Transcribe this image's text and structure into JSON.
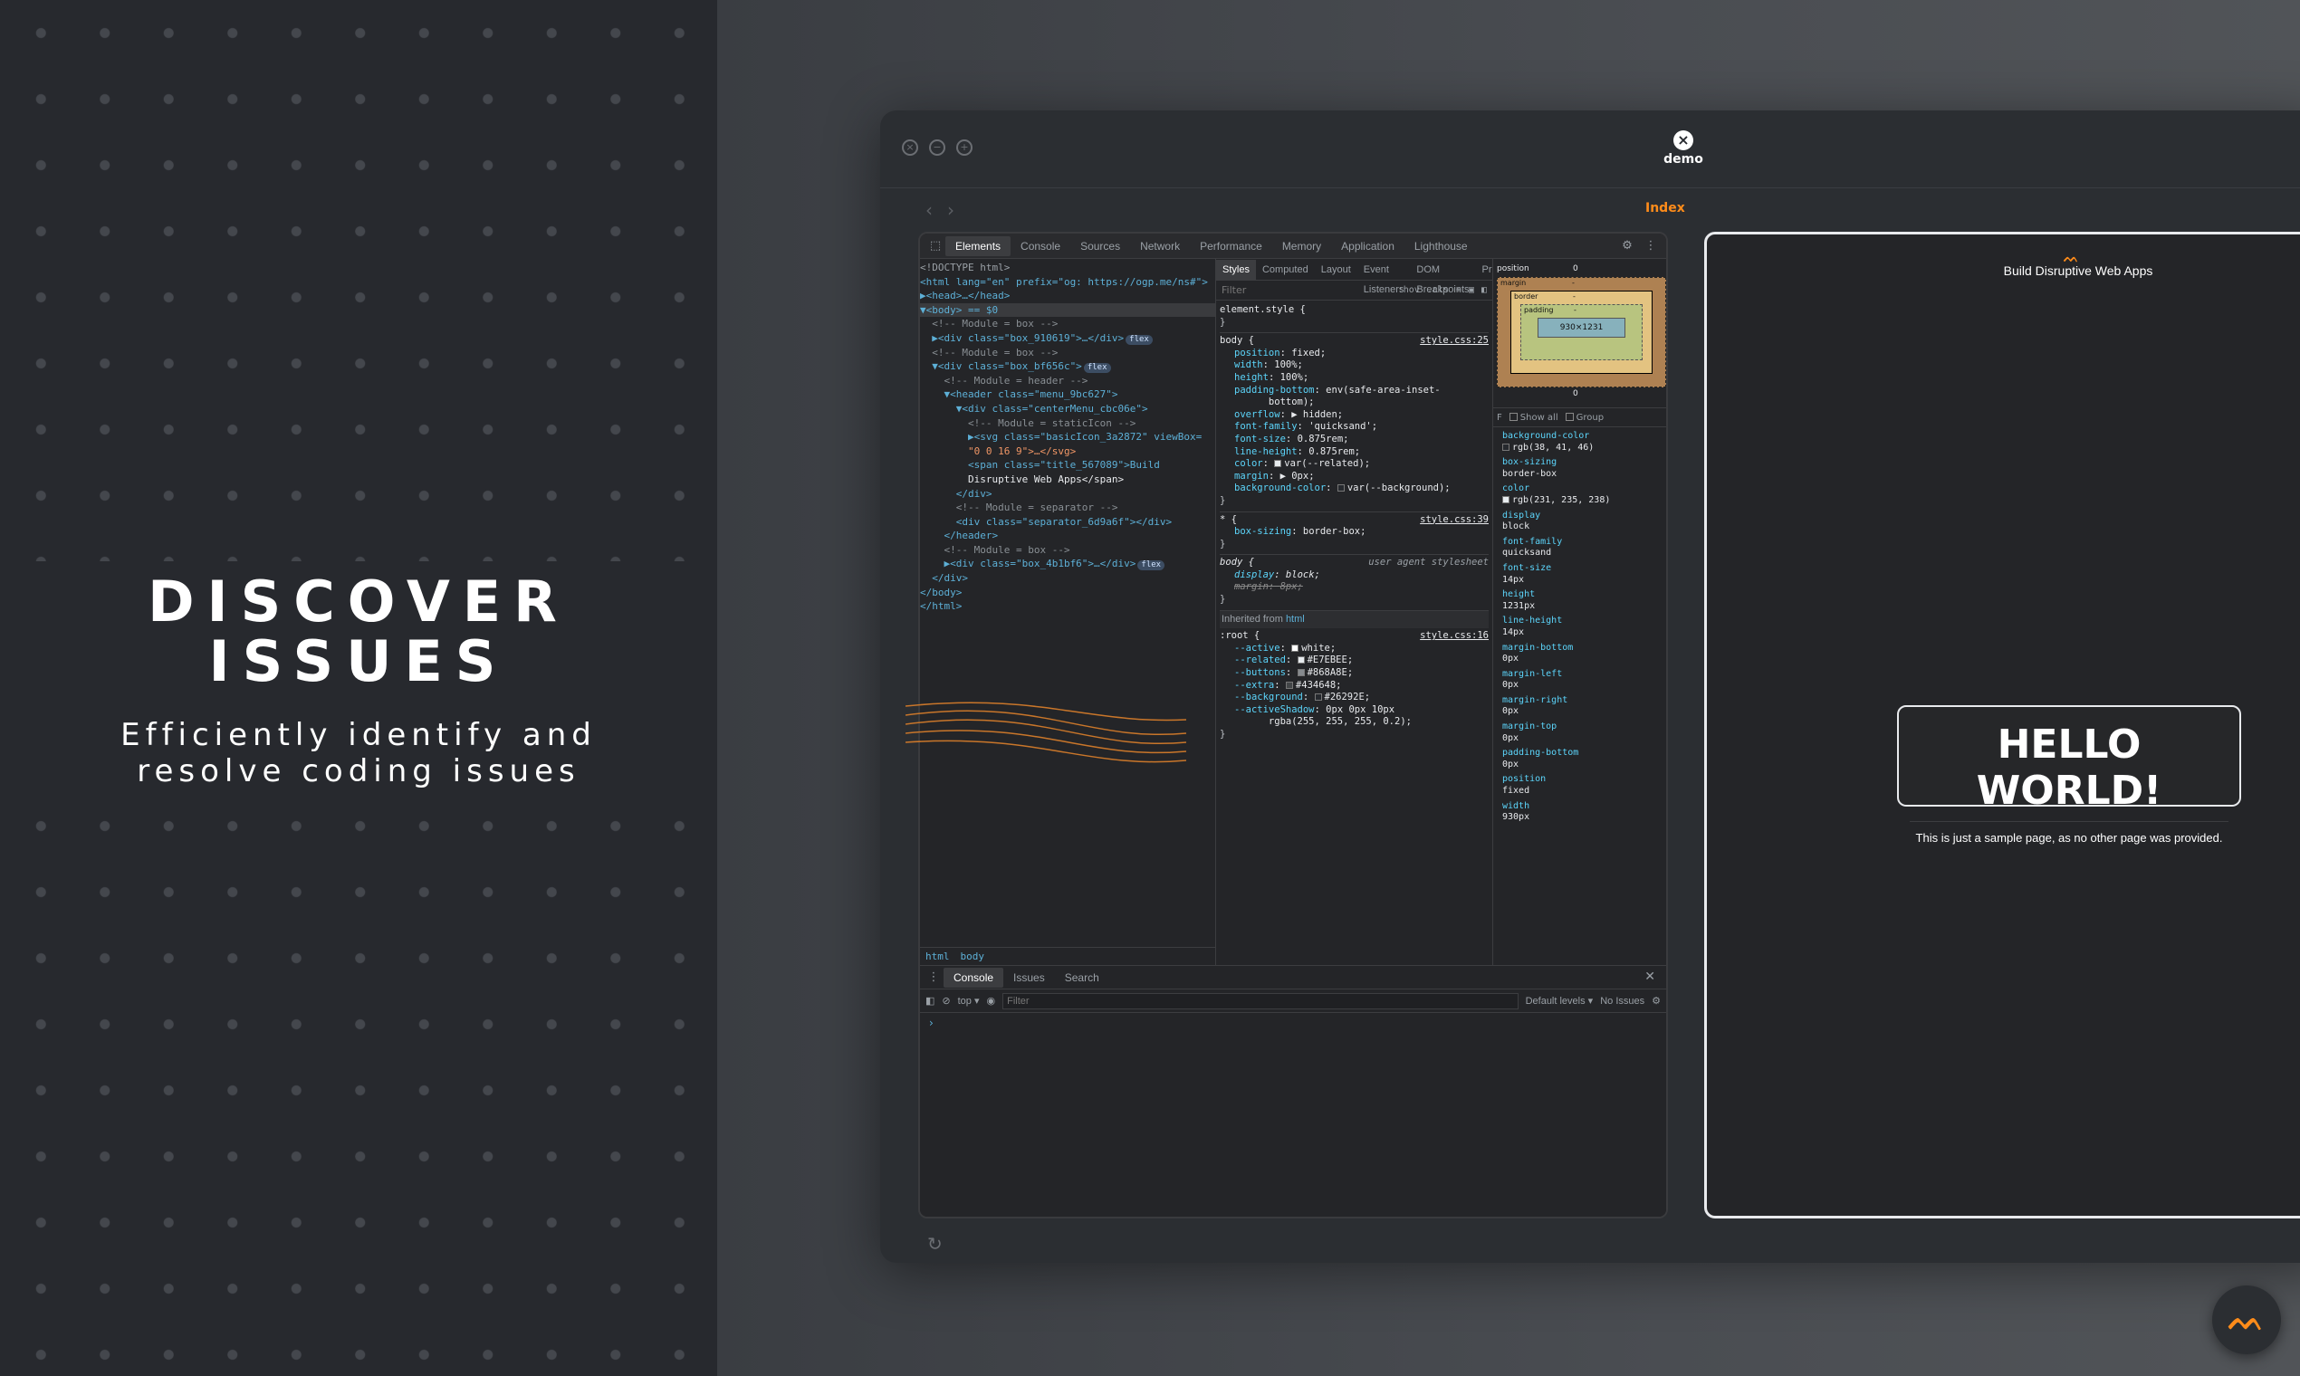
{
  "hero": {
    "headline_line1": "DISCOVER",
    "headline_line2": "ISSUES",
    "subline_line1": "Efficiently identify and",
    "subline_line2": "resolve coding issues"
  },
  "window": {
    "app_name": "demo",
    "route": "Index",
    "back_icon": "chevron-left-icon",
    "forward_icon": "chevron-right-icon",
    "reload_icon": "reload-icon",
    "controls": [
      "close-icon",
      "minimize-icon",
      "maximize-icon"
    ]
  },
  "devtools": {
    "tabs": [
      "Elements",
      "Console",
      "Sources",
      "Network",
      "Performance",
      "Memory",
      "Application",
      "Lighthouse"
    ],
    "active_tab": "Elements",
    "dom": [
      "<!DOCTYPE html>",
      "<html lang=\"en\" prefix=\"og: https://ogp.me/ns#\">",
      "▶<head>…</head>",
      "▼<body> == $0",
      "  <!-- Module = box -->",
      "  ▶<div class=\"box_910619\">…</div>",
      "  <!-- Module = box -->",
      "  ▼<div class=\"box_bf656c\">",
      "    <!-- Module = header -->",
      "    ▼<header class=\"menu_9bc627\">",
      "      ▼<div class=\"centerMenu_cbc06e\">",
      "        <!-- Module = staticIcon -->",
      "        ▶<svg class=\"basicIcon_3a2872\" viewBox=",
      "        \"0 0 16 9\">…</svg>",
      "        <span class=\"title_567089\">Build",
      "        Disruptive Web Apps</span>",
      "      </div>",
      "      <!-- Module = separator -->",
      "      <div class=\"separator_6d9a6f\"></div>",
      "    </header>",
      "    <!-- Module = box -->",
      "    ▶<div class=\"box_4b1bf6\">…</div>",
      "  </div>",
      "</body>",
      "</html>"
    ],
    "badges": {
      "flex": "flex"
    },
    "breadcrumbs": [
      "html",
      "body"
    ],
    "styles": {
      "tabs": [
        "Styles",
        "Computed",
        "Layout",
        "Event Listeners",
        "DOM Breakpoints",
        "Properties"
      ],
      "active_tab": "Styles",
      "filter_placeholder": "Filter",
      "hov": ":hov",
      "cls": ".cls",
      "element_style": "element.style {",
      "close_brace": "}",
      "body_rule": {
        "selector": "body {",
        "source": "style.css:25",
        "decls": [
          [
            "position",
            "fixed;"
          ],
          [
            "width",
            "100%;"
          ],
          [
            "height",
            "100%;"
          ],
          [
            "padding-bottom",
            "env(safe-area-inset-\n      bottom);"
          ],
          [
            "overflow",
            "▶ hidden;"
          ],
          [
            "font-family",
            "'quicksand';"
          ],
          [
            "font-size",
            "0.875rem;"
          ],
          [
            "line-height",
            "0.875rem;"
          ],
          [
            "color",
            "var(--related);"
          ],
          [
            "margin",
            "▶ 0px;"
          ],
          [
            "background-color",
            "var(--background);"
          ]
        ]
      },
      "star_rule": {
        "selector": "* {",
        "source": "style.css:39",
        "decls": [
          [
            "box-sizing",
            "border-box;"
          ]
        ]
      },
      "ua_rule": {
        "selector": "body {",
        "source": "user agent stylesheet",
        "decls": [
          [
            "display",
            "block;"
          ],
          [
            "margin",
            "8px;"
          ]
        ]
      },
      "inherited_label": "Inherited from",
      "inherited_from": "html",
      "root_rule": {
        "selector": ":root {",
        "source": "style.css:16",
        "decls": [
          [
            "--active",
            "white;"
          ],
          [
            "--related",
            "#E7EBEE;"
          ],
          [
            "--buttons",
            "#868A8E;"
          ],
          [
            "--extra",
            "#434648;"
          ],
          [
            "--background",
            "#26292E;"
          ],
          [
            "--activeShadow",
            "0px 0px 10px\n      rgba(255, 255, 255, 0.2);"
          ]
        ]
      }
    },
    "computed": {
      "position_label": "position",
      "position_value": "0",
      "margin_label": "margin",
      "margin_value": "-",
      "border_label": "border",
      "border_value": "-",
      "padding_label": "padding",
      "padding_value": "-",
      "content_size": "930×1231",
      "bottom_value": "0",
      "filter_label": "F",
      "show_all": "Show all",
      "group": "Group",
      "props": [
        [
          "background-color",
          "rgb(38, 41, 46)"
        ],
        [
          "box-sizing",
          "border-box"
        ],
        [
          "color",
          "rgb(231, 235, 238)"
        ],
        [
          "display",
          "block"
        ],
        [
          "font-family",
          "quicksand"
        ],
        [
          "font-size",
          "14px"
        ],
        [
          "height",
          "1231px"
        ],
        [
          "line-height",
          "14px"
        ],
        [
          "margin-bottom",
          "0px"
        ],
        [
          "margin-left",
          "0px"
        ],
        [
          "margin-right",
          "0px"
        ],
        [
          "margin-top",
          "0px"
        ],
        [
          "padding-bottom",
          "0px"
        ],
        [
          "position",
          "fixed"
        ],
        [
          "width",
          "930px"
        ]
      ]
    },
    "drawer": {
      "tabs": [
        "Console",
        "Issues",
        "Search"
      ],
      "active_tab": "Console",
      "context": "top ▾",
      "filter_placeholder": "Filter",
      "levels": "Default levels ▾",
      "issues": "No Issues",
      "prompt": "›"
    }
  },
  "preview": {
    "logo_glyph": "ᨓ",
    "title": "Build Disruptive Web Apps",
    "card_heading": "HELLO WORLD!",
    "card_text": "This is just a sample page, as no other page was provided."
  },
  "fab": {
    "glyph": "ᨓ"
  },
  "colors": {
    "accent": "#ff8c1a",
    "background": "#26292e"
  }
}
